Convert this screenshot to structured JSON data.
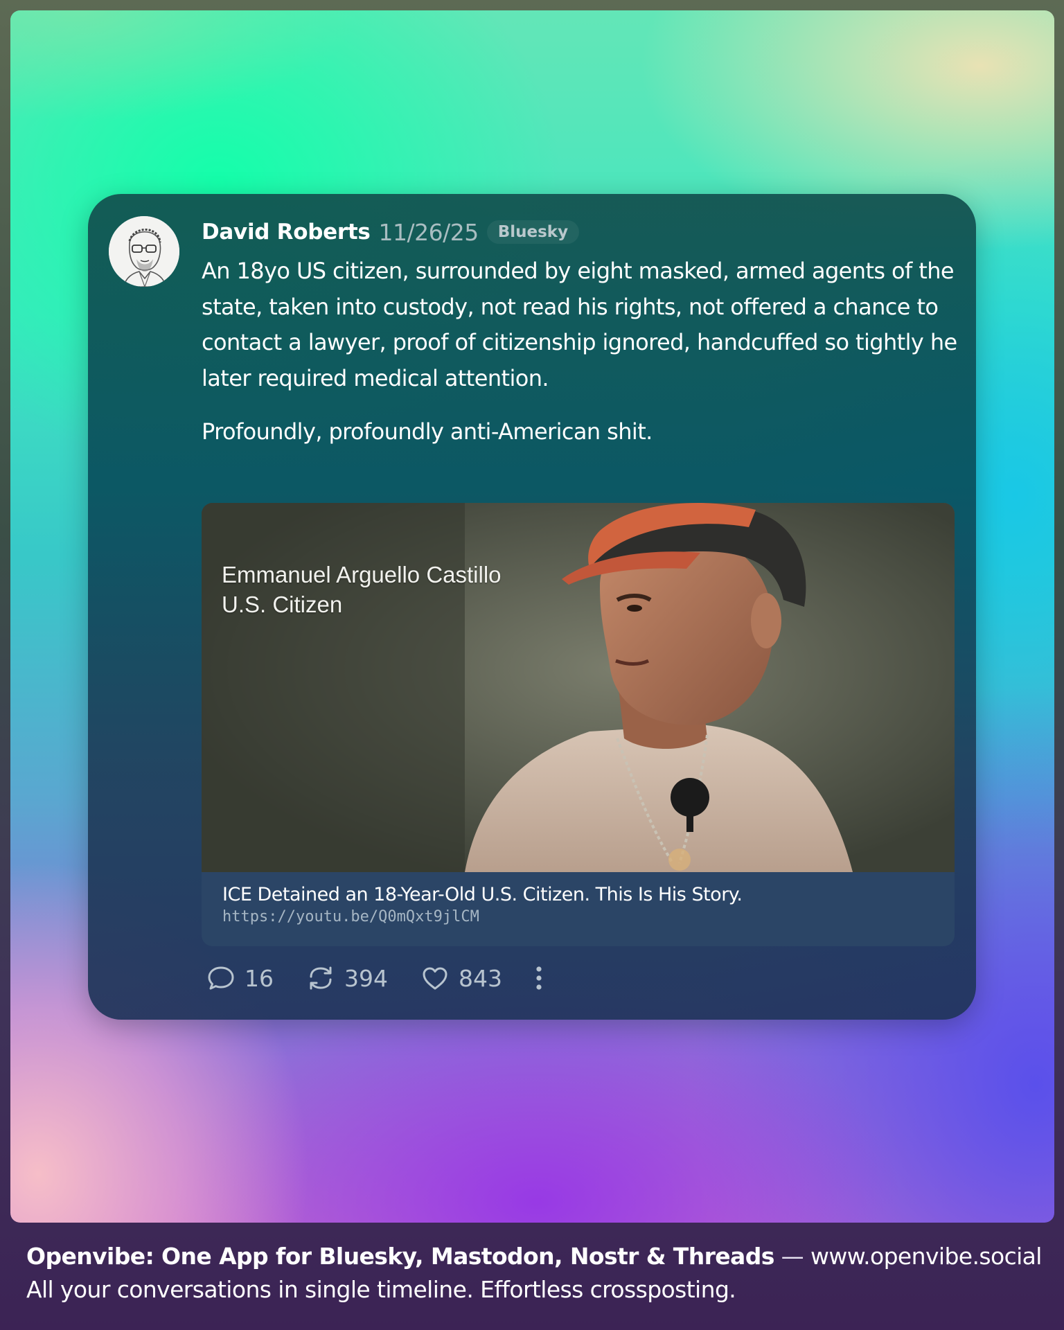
{
  "post": {
    "author": "David Roberts",
    "date": "11/26/25",
    "network": "Bluesky",
    "paragraphs": [
      "An 18yo US citizen, surrounded by eight masked, armed agents of the state, taken into custody, not read his rights, not offered a chance to contact a lawyer, proof of citizenship ignored, handcuffed so tightly he later required medical attention.",
      "Profoundly, profoundly anti-American shit."
    ],
    "avatar_icon": "sketch-portrait-avatar",
    "link": {
      "thumbnail_caption_line1": "Emmanuel Arguello Castillo",
      "thumbnail_caption_line2": "U.S. Citizen",
      "title": "ICE Detained an 18-Year-Old U.S. Citizen. This Is His Story.",
      "url": "https://youtu.be/Q0mQxt9jlCM"
    },
    "actions": {
      "replies": "16",
      "reposts": "394",
      "likes": "843",
      "reply_icon": "speech-bubble-icon",
      "repost_icon": "repost-arrows-icon",
      "like_icon": "heart-icon",
      "more_icon": "vertical-dots-icon"
    }
  },
  "footer": {
    "headline": "Openvibe: One App for Bluesky, Mastodon, Nostr & Threads",
    "separator": " — ",
    "site": "www.openvibe.social",
    "tagline": "All your conversations in single timeline. Effortless crossposting."
  },
  "colors": {
    "card_bg": "#0f4f5a",
    "text_primary": "#ffffff",
    "text_muted": "#a9bdc1",
    "link_card_bg": "#2b4566"
  }
}
